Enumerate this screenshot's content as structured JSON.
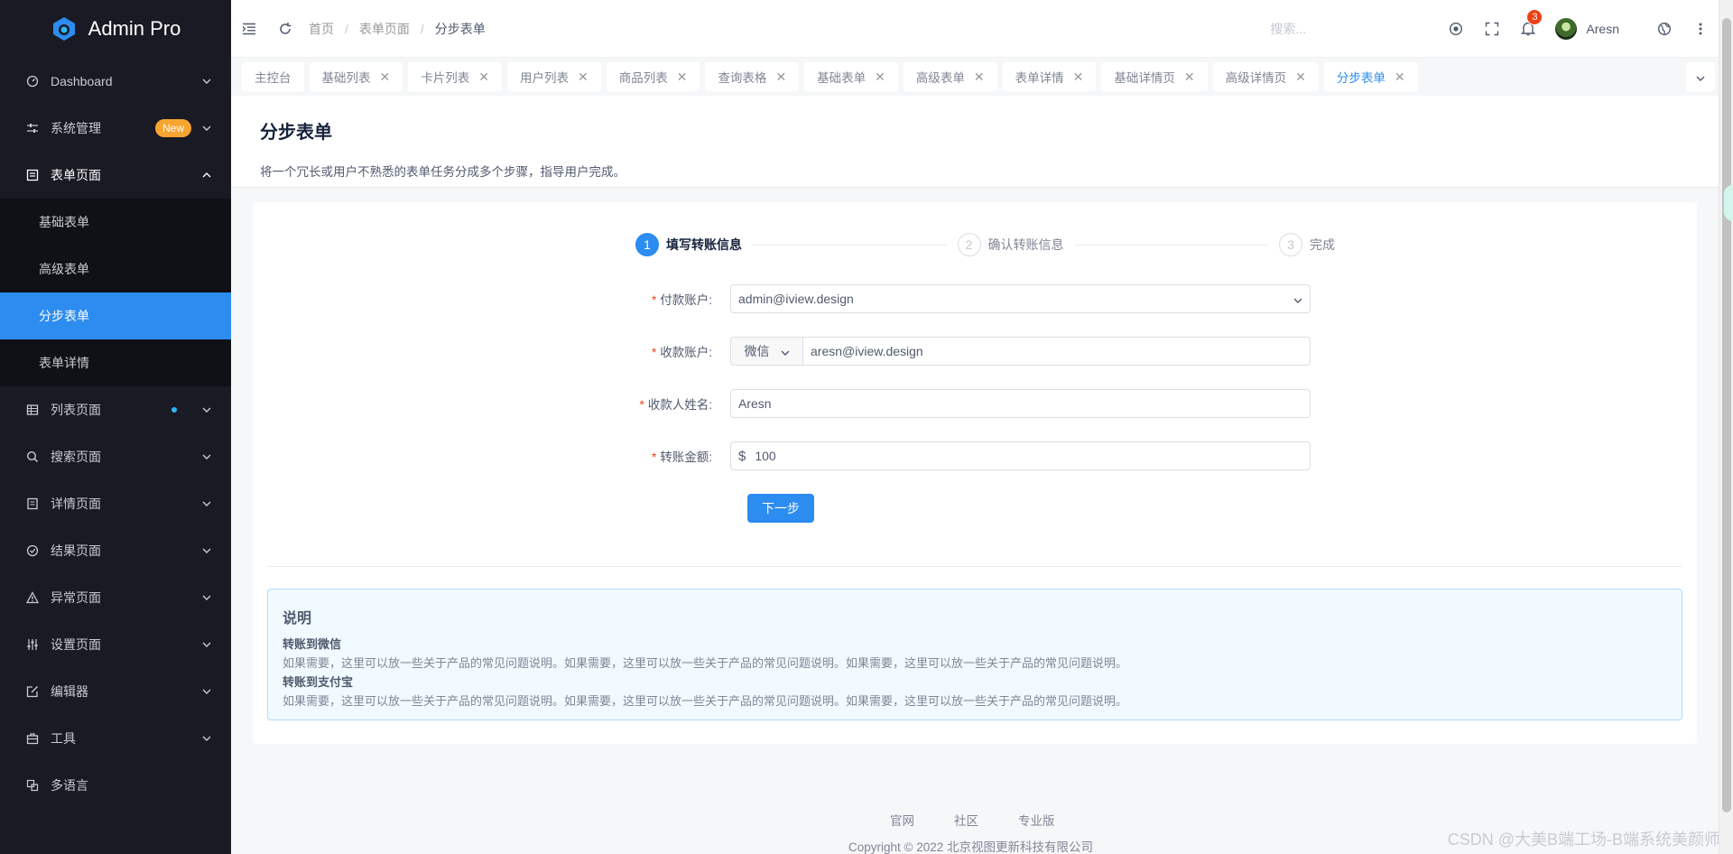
{
  "app": {
    "name": "Admin Pro"
  },
  "sidebar": {
    "items": [
      {
        "label": "Dashboard",
        "icon": "dashboard-icon"
      },
      {
        "label": "系统管理",
        "icon": "sliders-icon",
        "badge": "New"
      },
      {
        "label": "表单页面",
        "icon": "form-icon",
        "open": true,
        "children": [
          {
            "label": "基础表单"
          },
          {
            "label": "高级表单"
          },
          {
            "label": "分步表单",
            "active": true
          },
          {
            "label": "表单详情"
          }
        ]
      },
      {
        "label": "列表页面",
        "icon": "table-icon",
        "dot": true
      },
      {
        "label": "搜索页面",
        "icon": "search-icon"
      },
      {
        "label": "详情页面",
        "icon": "document-icon"
      },
      {
        "label": "结果页面",
        "icon": "check-circle-icon"
      },
      {
        "label": "异常页面",
        "icon": "warning-icon"
      },
      {
        "label": "设置页面",
        "icon": "settings-sliders-icon"
      },
      {
        "label": "编辑器",
        "icon": "edit-icon"
      },
      {
        "label": "工具",
        "icon": "toolbox-icon"
      },
      {
        "label": "多语言",
        "icon": "translate-icon"
      }
    ]
  },
  "header": {
    "breadcrumb": [
      "首页",
      "表单页面",
      "分步表单"
    ],
    "search_placeholder": "搜索...",
    "notifications": "3",
    "username": "Aresn"
  },
  "tabs": [
    {
      "label": "主控台",
      "closable": false
    },
    {
      "label": "基础列表",
      "closable": true
    },
    {
      "label": "卡片列表",
      "closable": true
    },
    {
      "label": "用户列表",
      "closable": true
    },
    {
      "label": "商品列表",
      "closable": true
    },
    {
      "label": "查询表格",
      "closable": true
    },
    {
      "label": "基础表单",
      "closable": true
    },
    {
      "label": "高级表单",
      "closable": true
    },
    {
      "label": "表单详情",
      "closable": true
    },
    {
      "label": "基础详情页",
      "closable": true
    },
    {
      "label": "高级详情页",
      "closable": true
    },
    {
      "label": "分步表单",
      "closable": true,
      "active": true
    }
  ],
  "page": {
    "title": "分步表单",
    "description": "将一个冗长或用户不熟悉的表单任务分成多个步骤，指导用户完成。"
  },
  "steps": [
    {
      "num": "1",
      "label": "填写转账信息",
      "active": true
    },
    {
      "num": "2",
      "label": "确认转账信息"
    },
    {
      "num": "3",
      "label": "完成"
    }
  ],
  "form": {
    "payer_label": "付款账户:",
    "payer_value": "admin@iview.design",
    "payee_label": "收款账户:",
    "payee_type": "微信",
    "payee_value": "aresn@iview.design",
    "name_label": "收款人姓名:",
    "name_value": "Aresn",
    "amount_label": "转账金额:",
    "amount_prefix": "$",
    "amount_value": "100",
    "next_label": "下一步"
  },
  "note": {
    "title": "说明",
    "sections": [
      {
        "heading": "转账到微信",
        "text": "如果需要，这里可以放一些关于产品的常见问题说明。如果需要，这里可以放一些关于产品的常见问题说明。如果需要，这里可以放一些关于产品的常见问题说明。"
      },
      {
        "heading": "转账到支付宝",
        "text": "如果需要，这里可以放一些关于产品的常见问题说明。如果需要，这里可以放一些关于产品的常见问题说明。如果需要，这里可以放一些关于产品的常见问题说明。"
      }
    ]
  },
  "footer": {
    "links": [
      "官网",
      "社区",
      "专业版"
    ],
    "copyright": "Copyright © 2022 北京视图更新科技有限公司"
  },
  "watermark": "CSDN @大美B端工场-B端系统美颜师",
  "colors": {
    "primary": "#2d8cf0",
    "sidebar_bg": "#191a23",
    "new_badge": "#f7a531",
    "danger": "#ed4014"
  }
}
